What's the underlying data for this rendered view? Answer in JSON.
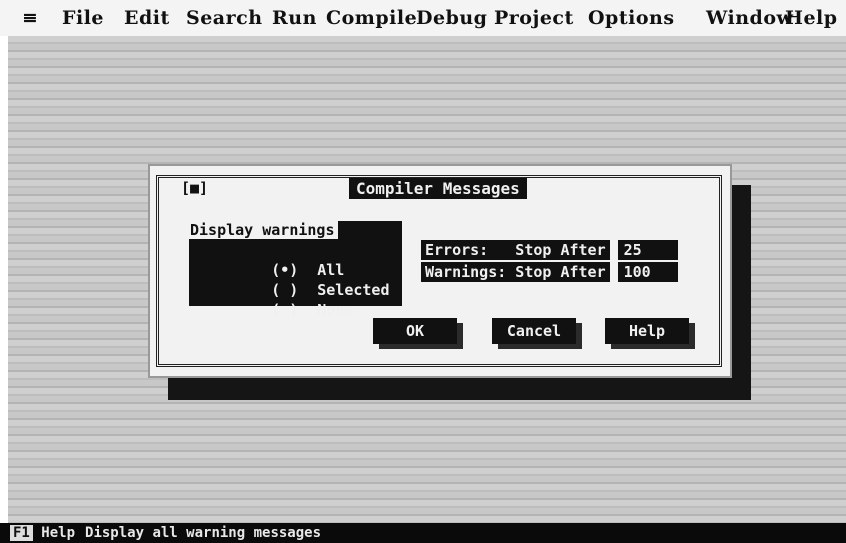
{
  "menubar": {
    "system": "≡",
    "items": [
      "File",
      "Edit",
      "Search",
      "Run",
      "Compile",
      "Debug",
      "Project",
      "Options",
      "Window",
      "Help"
    ]
  },
  "dialog": {
    "close_box": "[■]",
    "title": "Compiler Messages",
    "group_label": "Display warnings",
    "options": [
      {
        "mark": "(•)",
        "label": "All"
      },
      {
        "mark": "( )",
        "label": "Selected"
      },
      {
        "mark": "( )",
        "label": "None"
      }
    ],
    "errors_label": "Errors:   Stop After",
    "errors_value": "25",
    "warnings_label": "Warnings: Stop After",
    "warnings_value": "100",
    "buttons": {
      "ok": "OK",
      "cancel": "Cancel",
      "help": "Help"
    }
  },
  "statusbar": {
    "key": "F1",
    "key_label": "Help",
    "hint": "Display all warning messages"
  }
}
